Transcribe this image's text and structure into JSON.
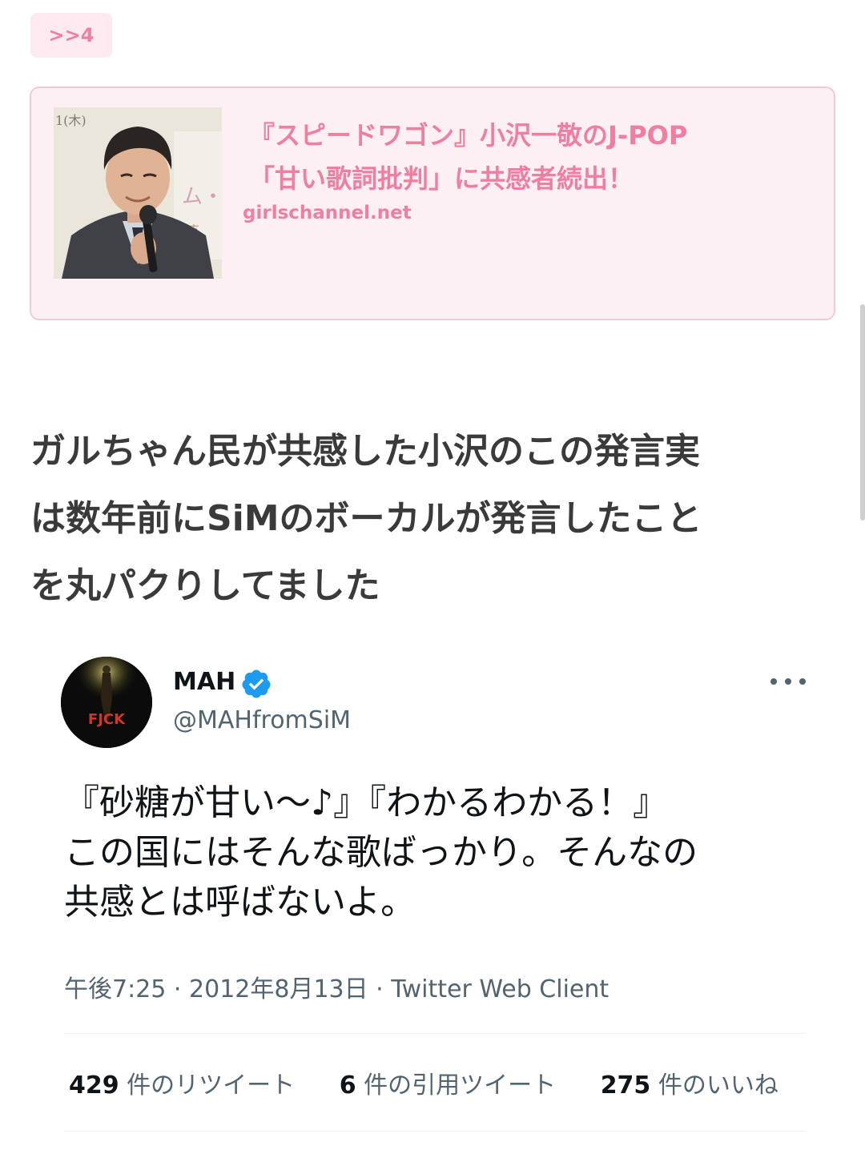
{
  "reply_badge": {
    "label": ">>4"
  },
  "link_card": {
    "title_line1": "『スピードワゴン』小沢一敬のJ-POP",
    "title_line2": "「甘い歌詞批判」に共感者続出！",
    "domain": "girlschannel.net",
    "thumbnail_caption": "1(木)",
    "colors": {
      "accent": "#f07ea0",
      "background": "#fdf0f4",
      "border": "#f6c8d6"
    }
  },
  "comment": {
    "line1": "ガルちゃん民が共感した小沢のこの発言実",
    "line2": "は数年前にSiMのボーカルが発言したこと",
    "line3": "を丸パクりしてました"
  },
  "tweet": {
    "name": "MAH",
    "handle": "@MAHfromSiM",
    "verified": true,
    "avatar_text": "FJCK",
    "text_line1": "『砂糖が甘い〜♪』『わかるわかる！』",
    "text_line2": "この国にはそんな歌ばっかり。そんなの",
    "text_line3": "共感とは呼ばないよ。",
    "time": "午後7:25",
    "date": "2012年8月13日",
    "client": "Twitter Web Client",
    "separator": "·",
    "retweets": {
      "count": "429",
      "label": "件のリツイート"
    },
    "quotes": {
      "count": "6",
      "label": "件の引用ツイート"
    },
    "likes": {
      "count": "275",
      "label": "件のいいね"
    },
    "icons": {
      "more": "more-horizontal-icon",
      "verified": "verified-badge-icon"
    },
    "colors": {
      "verified": "#1d9bf0",
      "text": "#0f1419",
      "secondary": "#536471"
    }
  }
}
